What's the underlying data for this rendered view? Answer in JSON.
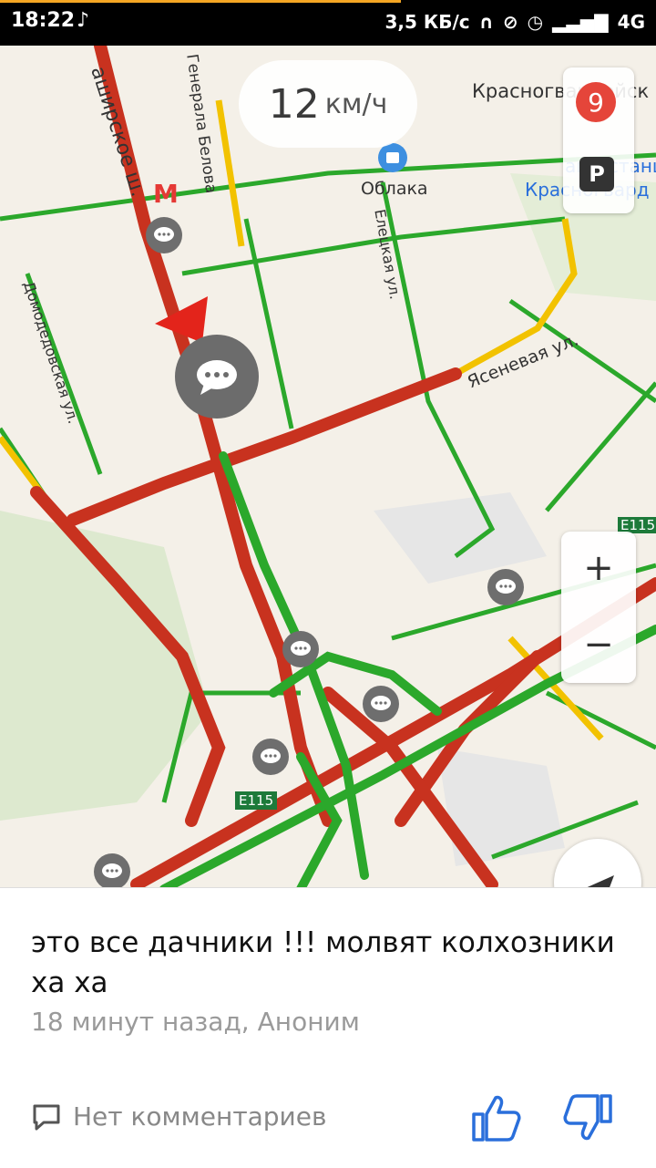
{
  "status_bar": {
    "time": "18:22",
    "network_speed": "3,5 КБ/с",
    "network_type": "4G",
    "progress_color": "#f5a623",
    "icons": [
      "tiktok-icon",
      "headphones-icon",
      "mute-icon",
      "alarm-icon",
      "signal-icon"
    ]
  },
  "map": {
    "speed": {
      "value": "12",
      "unit": "км/ч"
    },
    "badge_count": "9",
    "parking_label": "P",
    "zoom_in_label": "+",
    "zoom_out_label": "−",
    "labels": {
      "kashirskoe": "аширское ш.",
      "generala_belova": "Генерала Белова",
      "oblaka": "Облака",
      "yeletskaya": "Елецкая ул.",
      "domodedovskaya": "Домодедовская ул.",
      "yasenevaya": "Ясеневая ул.",
      "krasnogvardeyskaya": "Красногвардейск",
      "avtostantsiya": "автостанц",
      "krasnogvard": "Красногвард",
      "e115_top": "E115",
      "e115_bottom": "E115"
    },
    "colors": {
      "red": "#c8321f",
      "yellow": "#f2c200",
      "green": "#2ba82b",
      "metro": "#e53935"
    }
  },
  "comment": {
    "text": "это все дачники !!! молвят колхозники ха ха",
    "meta": "18 минут назад, Аноним",
    "comments_label": "Нет комментариев",
    "like_color": "#2a6fdb"
  }
}
